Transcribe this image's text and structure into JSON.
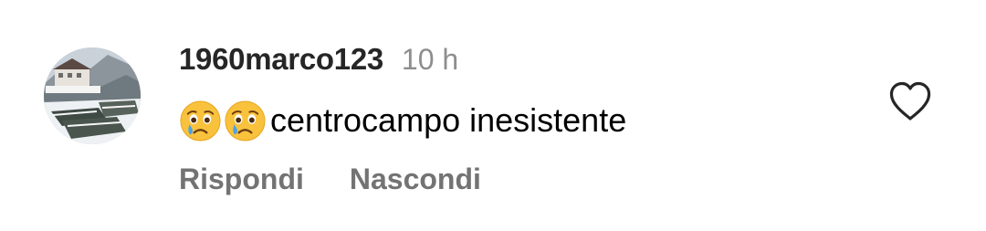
{
  "comment": {
    "username": "1960marco123",
    "time": "10 h",
    "emojis": [
      "crying-face",
      "crying-face"
    ],
    "text": "centrocampo inesistente",
    "actions": {
      "reply": "Rispondi",
      "hide": "Nascondi"
    },
    "like_icon": "heart-outline-icon"
  },
  "colors": {
    "username": "#262626",
    "meta": "#8e8e8e",
    "action": "#737373",
    "text": "#000000"
  }
}
